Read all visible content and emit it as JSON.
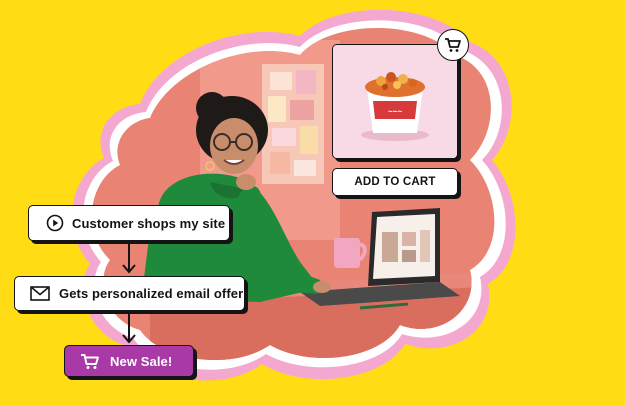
{
  "flow": {
    "step1": {
      "label": "Customer shops my site",
      "icon": "play-circle-icon"
    },
    "step2": {
      "label": "Gets personalized email offer",
      "icon": "envelope-icon"
    },
    "result": {
      "label": "New Sale!",
      "icon": "shopping-cart-icon"
    }
  },
  "product": {
    "image": "snack-cup-photo",
    "button_label": "ADD TO CART",
    "badge_icon": "shopping-cart-icon"
  },
  "scene": {
    "subject": "woman-at-laptop-photo"
  },
  "colors": {
    "background": "#FFDC14",
    "blob_outer": "#F5A8CF",
    "blob_inner": "#FFFFFF",
    "sale_button": "#A939A6",
    "outline": "#141414"
  }
}
